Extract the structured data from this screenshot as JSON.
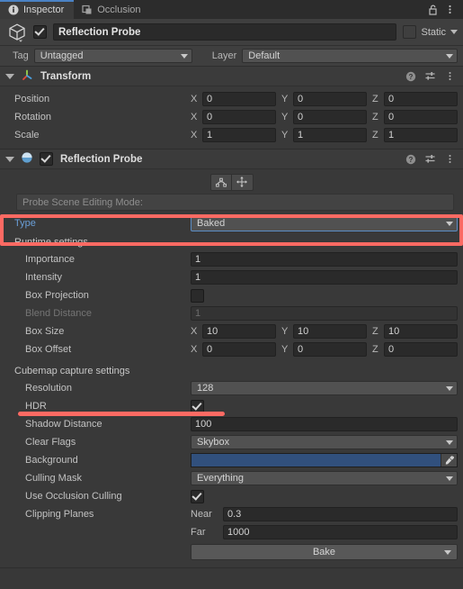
{
  "window": {
    "tabs": [
      {
        "label": "Inspector",
        "icon": "info-icon",
        "active": true
      },
      {
        "label": "Occlusion",
        "icon": "occlusion-icon",
        "active": false
      }
    ],
    "lock_icon": "padlock-open-icon",
    "menu_icon": "kebab-menu-icon"
  },
  "object_header": {
    "icon": "prefab-cube-icon",
    "enabled": true,
    "name": "Reflection Probe",
    "static_checked": false,
    "static_label": "Static"
  },
  "tag_layer": {
    "tag_label": "Tag",
    "tag_value": "Untagged",
    "layer_label": "Layer",
    "layer_value": "Default"
  },
  "transform": {
    "title": "Transform",
    "icon": "transform-axis-icon",
    "expanded": true,
    "rows": [
      {
        "label": "Position",
        "x": "0",
        "y": "0",
        "z": "0"
      },
      {
        "label": "Rotation",
        "x": "0",
        "y": "0",
        "z": "0"
      },
      {
        "label": "Scale",
        "x": "1",
        "y": "1",
        "z": "1"
      }
    ],
    "axis_x": "X",
    "axis_y": "Y",
    "axis_z": "Z"
  },
  "reflection_probe": {
    "title": "Reflection Probe",
    "icon": "reflection-probe-icon",
    "enabled": true,
    "expanded": true,
    "edit_tools": [
      {
        "name": "edit-bounding-volume-button"
      },
      {
        "name": "move-probe-origin-button"
      }
    ],
    "help_text": "Probe Scene Editing Mode:",
    "type_label": "Type",
    "type_value": "Baked",
    "runtime_title": "Runtime settings",
    "importance_label": "Importance",
    "importance_value": "1",
    "intensity_label": "Intensity",
    "intensity_value": "1",
    "box_projection_label": "Box Projection",
    "box_projection_checked": false,
    "blend_distance_label": "Blend Distance",
    "blend_distance_value": "1",
    "box_size_label": "Box Size",
    "box_size": {
      "x": "10",
      "y": "10",
      "z": "10"
    },
    "box_offset_label": "Box Offset",
    "box_offset": {
      "x": "0",
      "y": "0",
      "z": "0"
    },
    "cubemap_title": "Cubemap capture settings",
    "resolution_label": "Resolution",
    "resolution_value": "128",
    "hdr_label": "HDR",
    "hdr_checked": true,
    "shadow_distance_label": "Shadow Distance",
    "shadow_distance_value": "100",
    "clear_flags_label": "Clear Flags",
    "clear_flags_value": "Skybox",
    "background_label": "Background",
    "background_color": "#31507d",
    "eyedropper_icon": "eyedropper-icon",
    "culling_mask_label": "Culling Mask",
    "culling_mask_value": "Everything",
    "occlusion_culling_label": "Use Occlusion Culling",
    "occlusion_culling_checked": true,
    "clipping_planes_label": "Clipping Planes",
    "near_label": "Near",
    "near_value": "0.3",
    "far_label": "Far",
    "far_value": "1000",
    "bake_label": "Bake"
  },
  "component_header_icons": {
    "help": "help-question-icon",
    "preset": "preset-sliders-icon",
    "menu": "kebab-menu-icon"
  },
  "annotations": {
    "highlight_color": "#fd6a63",
    "type_row_box": "highlight-box-type-row",
    "resolution_underline": "highlight-underline-resolution"
  }
}
